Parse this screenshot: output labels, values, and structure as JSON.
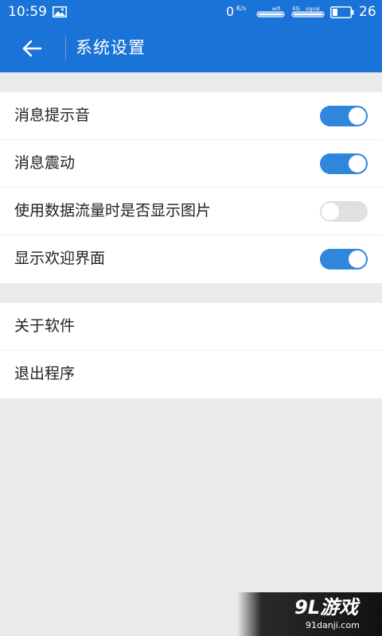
{
  "status_bar": {
    "time": "10:59",
    "net_speed": "0",
    "net_speed_unit": "K/s",
    "wifi_label": "wifi",
    "signal_type": "4G",
    "signal_label": "signal",
    "battery": "26"
  },
  "header": {
    "title": "系统设置"
  },
  "settings": {
    "items": [
      {
        "label": "消息提示音",
        "on": true
      },
      {
        "label": "消息震动",
        "on": true
      },
      {
        "label": "使用数据流量时是否显示图片",
        "on": false
      },
      {
        "label": "显示欢迎界面",
        "on": true
      }
    ]
  },
  "actions": {
    "items": [
      {
        "label": "关于软件"
      },
      {
        "label": "退出程序"
      }
    ]
  },
  "watermark": {
    "logo": "9L游戏",
    "url": "91danji.com"
  },
  "colors": {
    "primary": "#1a73d6",
    "toggle_on": "#2f86dc",
    "toggle_off": "#e0e0e0",
    "background": "#ebebeb"
  }
}
